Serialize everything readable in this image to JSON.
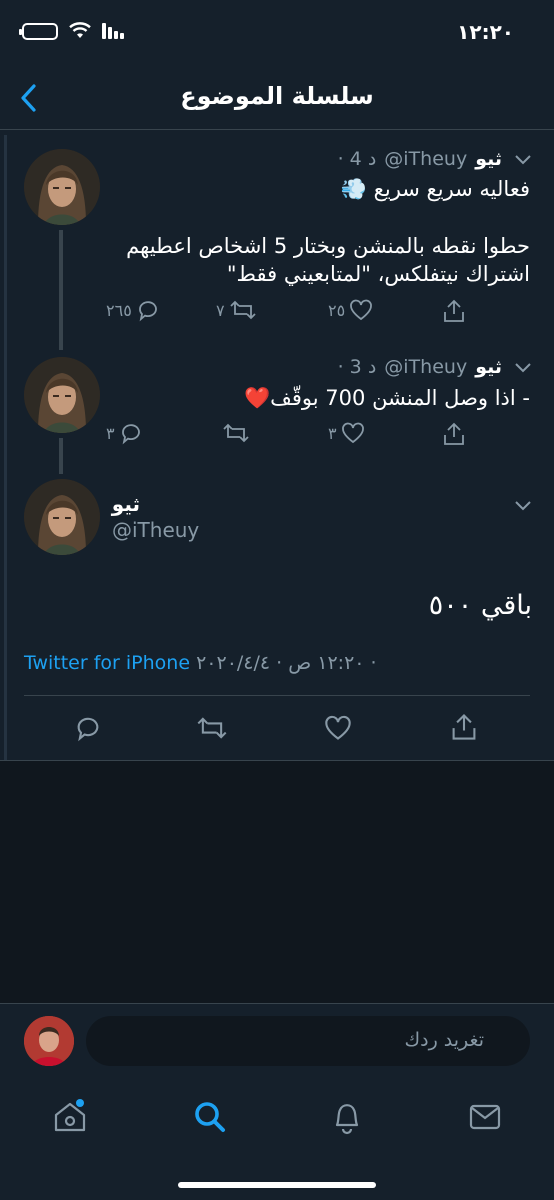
{
  "status": {
    "time": "١٢:٢٠"
  },
  "nav": {
    "title": "سلسلة الموضوع"
  },
  "tweets": [
    {
      "name": "ثيو",
      "handle": "@iTheuy",
      "time": "· 4 د",
      "lines": [
        "فعاليه سريع سريع 💨",
        "",
        "حطوا نقطه بالمنشن وبختار 5 اشخاص اعطيهم",
        "اشتراك نيتفلكس، \"لمتابعيني فقط\""
      ],
      "replies": "٢٦٥",
      "retweets": "٧",
      "likes": "٢٥"
    },
    {
      "name": "ثيو",
      "handle": "@iTheuy",
      "time": "· 3 د",
      "lines": [
        "- اذا وصل المنشن 700 بوقّف❤️"
      ],
      "replies": "٣",
      "retweets": "",
      "likes": "٣"
    }
  ],
  "main_tweet": {
    "name": "ثيو",
    "handle": "@iTheuy",
    "text": "باقي ٥٠٠",
    "meta": "١٢:٢٠ ص · ٢٠٢٠/٤/٤ · ",
    "source": "Twitter for iPhone"
  },
  "reply": {
    "placeholder": "تغريد ردك"
  },
  "tabs": [
    "home-icon",
    "search-icon",
    "notifications-icon",
    "messages-icon"
  ],
  "colors": {
    "background": "#15202b",
    "accent": "#1da1f2",
    "muted": "#8899a6",
    "heart": "#e0245e"
  }
}
